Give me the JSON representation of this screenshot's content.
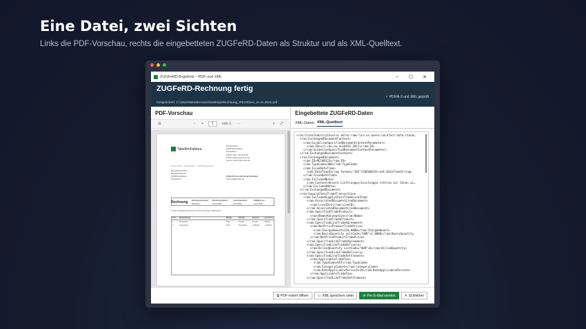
{
  "hero": {
    "title": "Eine Datei, zwei Sichten",
    "subtitle": "Links die PDF-Vorschau, rechts die eingebetteten ZUGFeRD-Daten als Struktur und als XML-Quelltext."
  },
  "window": {
    "title": "ZUGFeRD-Ergebnis – PDF und XML",
    "min": "–",
    "max": "☐",
    "close": "✕"
  },
  "banner": {
    "title": "ZUGFeRD-Rechnung fertig",
    "path": "Gespeichert: C:\\Users\\Mustermann\\Desktop\\Rechnung_RE100xxx_xx.xx.202x.pdf",
    "status": "✓ PDF/A-3 und XML geprüft"
  },
  "left": {
    "heading": "PDF-Vorschau",
    "toolbar": {
      "menu": "☰",
      "minus": "−",
      "plus": "+",
      "fit": "⬚",
      "page": "1",
      "page_of": "von 1",
      "more": "···",
      "search": "⌕",
      "expand": "⤢"
    },
    "doc": {
      "logo": "TabellenFaktura",
      "sender": [
        "Musterstraße 6",
        "12345 Musterhausen",
        "Deutschland",
        "Telefon: 0123 - 987 654 321",
        "E-Mail: info@muster-firma.de",
        "Internet: www.muster-firma.de"
      ],
      "recipient": [
        "Beispielfirma GmbH",
        "Beispielstraße 123",
        "54748 Beispielburg",
        "Deutschland"
      ],
      "einvoice": [
        "E-Mail-Adresse Rechnung Empfänger",
        "rechnung@beispiel.de"
      ],
      "sender_line": "Muster GmbH · Musterstraße 6 · 12345 Musterhausen",
      "invoice_title": "Rechnung",
      "meta_labels": [
        "Rechnungsnummer:",
        "Rechnungsdatum:",
        "Leistungsdatum:",
        "Fälligkeit am:"
      ],
      "meta_values": [
        "RE100123",
        "19.06.2026",
        "19.06.2026",
        "19.06.2026"
      ],
      "intro": "Unsere Leistungen berechnen wir Ihnen wie folgt in Rechnung:",
      "table_headers": [
        "Pos.",
        "Bezeichnung",
        "Menge",
        "Einheit",
        "Einzel €",
        "Gesamt €"
      ],
      "rows": [
        [
          "1",
          "Konzeption",
          "6,00",
          "Stunde",
          "110,00",
          "660,00"
        ],
        [
          "2",
          "Umsetzung",
          "1,00",
          "Pauschale",
          "1.450,00",
          "1.450,00"
        ]
      ]
    }
  },
  "right": {
    "heading": "Eingebettete ZUGFeRD-Daten",
    "tabs": [
      "XML-Daten",
      "XML-Quelltext"
    ],
    "xml_lines": [
      "<rsm:CrossIndustryInvoice xmlns:ram=\"urn:un:unece:uncefact:data:stand…",
      "  <rsm:ExchangedDocumentContext>",
      "    <ram:GuidelineSpecifiedDocumentContextParameter>",
      "      <ram:ID>urn:cen.eu:en16931:2017</ram:ID>",
      "    </ram:GuidelineSpecifiedDocumentContextParameter>",
      "  </rsm:ExchangedDocumentContext>",
      "  <rsm:ExchangedDocument>",
      "    <ram:ID>RE100123</ram:ID>",
      "    <ram:TypeCode>380</ram:TypeCode>",
      "    <ram:IssueDateTime>",
      "      <udt:DateTimeString format=\"102\">20260619</udt:DateTimeString>",
      "    </ram:IssueDateTime>",
      "    <ram:IncludedNote>",
      "      <ram:Content>Unsere Lieferungen/Leistungen stellen wir Ihnen wi…",
      "    </ram:IncludedNote>",
      "  </rsm:ExchangedDocument>",
      "  <rsm:SupplyChainTradeTransaction>",
      "    <ram:IncludedSupplyChainTradeLineItem>",
      "      <ram:AssociatedDocumentLineDocument>",
      "        <ram:LineID>1</ram:LineID>",
      "      </ram:AssociatedDocumentLineDocument>",
      "      <ram:SpecifiedTradeProduct>",
      "        <ram:Name>Konzeption</ram:Name>",
      "      </ram:SpecifiedTradeProduct>",
      "      <ram:SpecifiedLineTradeAgreement>",
      "        <ram:NetPriceProductTradePrice>",
      "          <ram:ChargeAmount>110.0000</ram:ChargeAmount>",
      "          <ram:BasisQuantity unitCode=\"HUR\">1.0000</ram:BasisQuantity",
      "        </ram:NetPriceProductTradePrice>",
      "      </ram:SpecifiedLineTradeAgreement>",
      "      <ram:SpecifiedLineTradeDelivery>",
      "        <ram:BilledQuantity unitCode=\"HUR\">6</ram:BilledQuantity>",
      "      </ram:SpecifiedLineTradeDelivery>",
      "      <ram:SpecifiedLineTradeSettlement>",
      "        <ram:ApplicableTradeTax>",
      "          <ram:TypeCode>VAT</ram:TypeCode>",
      "          <ram:CategoryCode>S</ram:CategoryCode>",
      "          <ram:RateApplicablePercent>19</ram:RateApplicablePercent>",
      "        </ram:ApplicableTradeTax>",
      "      </ram:SpecifiedLineTradeSettlement>"
    ]
  },
  "footer": {
    "open_pdf": "PDF extern öffnen",
    "save_xml": "XML speichern unter",
    "send_mail": "Per E-Mail senden",
    "close": "Schließen"
  },
  "colors": {
    "accent_green": "#1e7e3e",
    "banner": "#1d3447"
  }
}
